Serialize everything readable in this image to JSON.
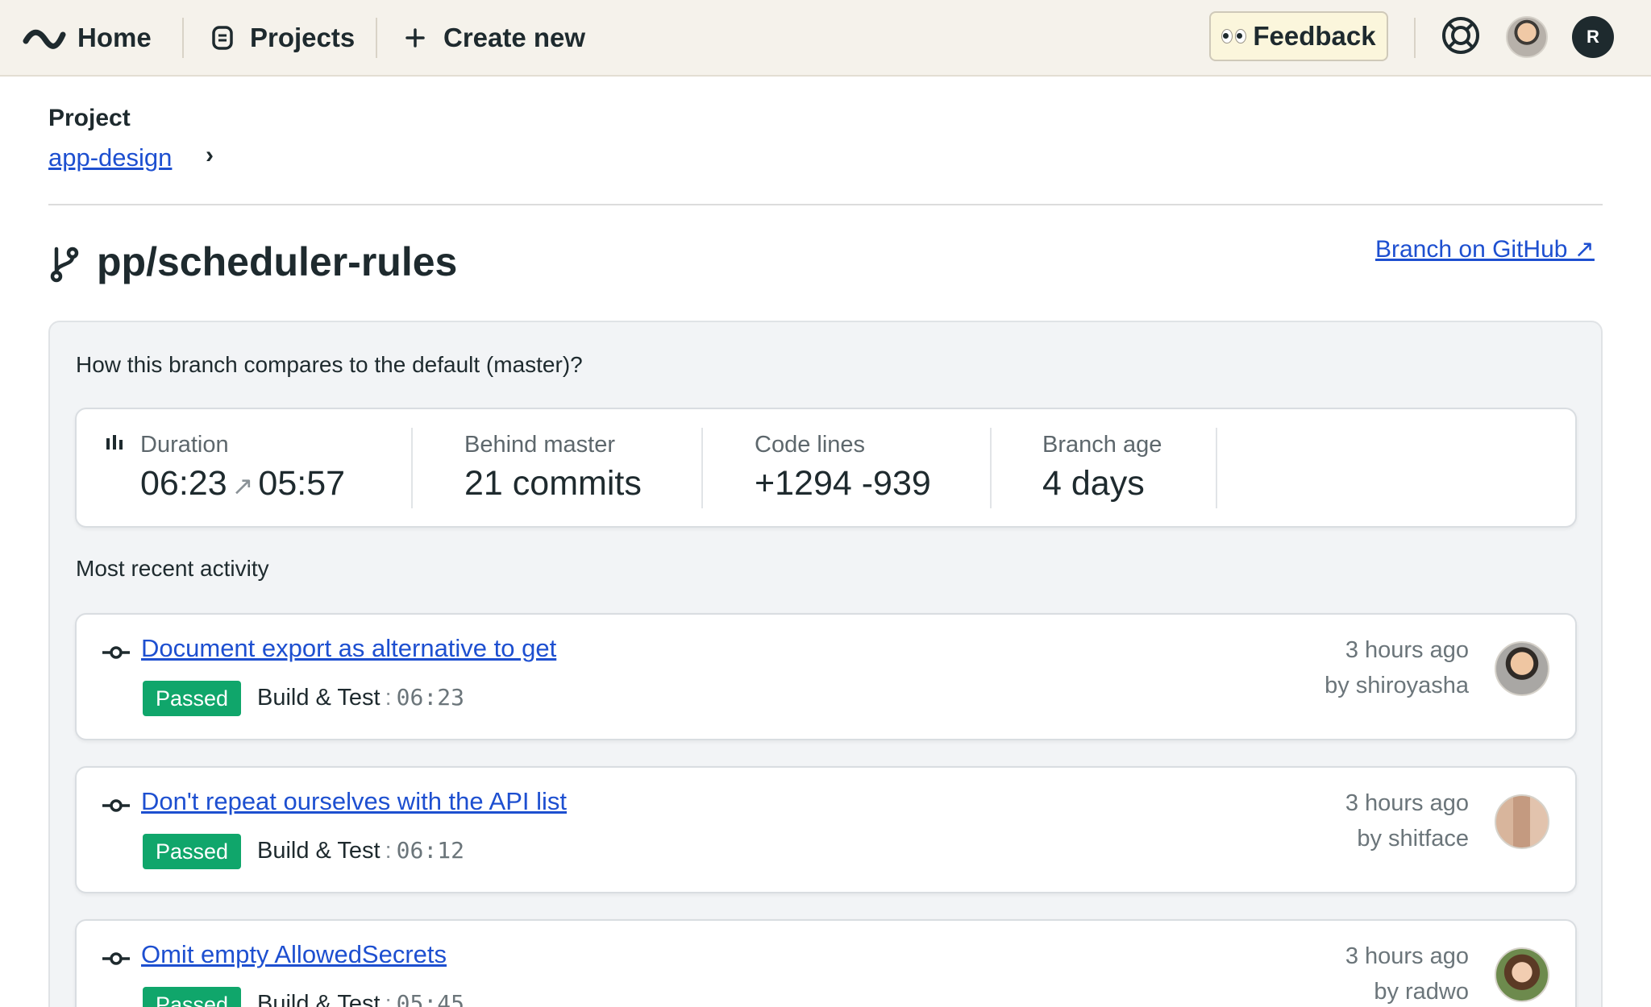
{
  "nav": {
    "home_label": "Home",
    "projects_label": "Projects",
    "create_label": "Create new",
    "feedback_label": "Feedback",
    "user_initial": "R"
  },
  "breadcrumb": {
    "label": "Project",
    "project_link": "app-design",
    "chevron": "›"
  },
  "branch": {
    "name": "pp/scheduler-rules",
    "github_link": "Branch on GitHub ↗"
  },
  "comparison": {
    "question": "How this branch compares to the default (master)?",
    "stats": [
      {
        "label": "Duration",
        "value_from": "06:23",
        "arrow": "↗",
        "value_to": "05:57"
      },
      {
        "label": "Behind master",
        "value": "21 commits"
      },
      {
        "label": "Code lines",
        "value": "+1294 -939"
      },
      {
        "label": "Branch age",
        "value": "4 days"
      }
    ]
  },
  "activity": {
    "heading": "Most recent activity",
    "items": [
      {
        "title": "Document export as alternative to get",
        "status": "Passed",
        "pipeline": "Build & Test",
        "sep": ":",
        "duration": "06:23",
        "time": "3 hours ago",
        "author": "by shiroyasha"
      },
      {
        "title": "Don't repeat ourselves with the API list",
        "status": "Passed",
        "pipeline": "Build & Test",
        "sep": ":",
        "duration": "06:12",
        "time": "3 hours ago",
        "author": "by shitface"
      },
      {
        "title": "Omit empty AllowedSecrets",
        "status": "Passed",
        "pipeline": "Build & Test",
        "sep": ":",
        "duration": "05:45",
        "time": "3 hours ago",
        "author": "by radwo"
      }
    ]
  },
  "colors": {
    "topbar_bg": "#f5f2eb",
    "link": "#1d4fd0",
    "passed_badge": "#10a66b",
    "panel_bg": "#f2f4f6"
  },
  "icons": [
    "semaphore-logo-icon",
    "projects-icon",
    "plus-icon",
    "eyes-icon",
    "help-lifebuoy-icon",
    "branch-icon",
    "bar-chart-icon",
    "commit-icon"
  ]
}
